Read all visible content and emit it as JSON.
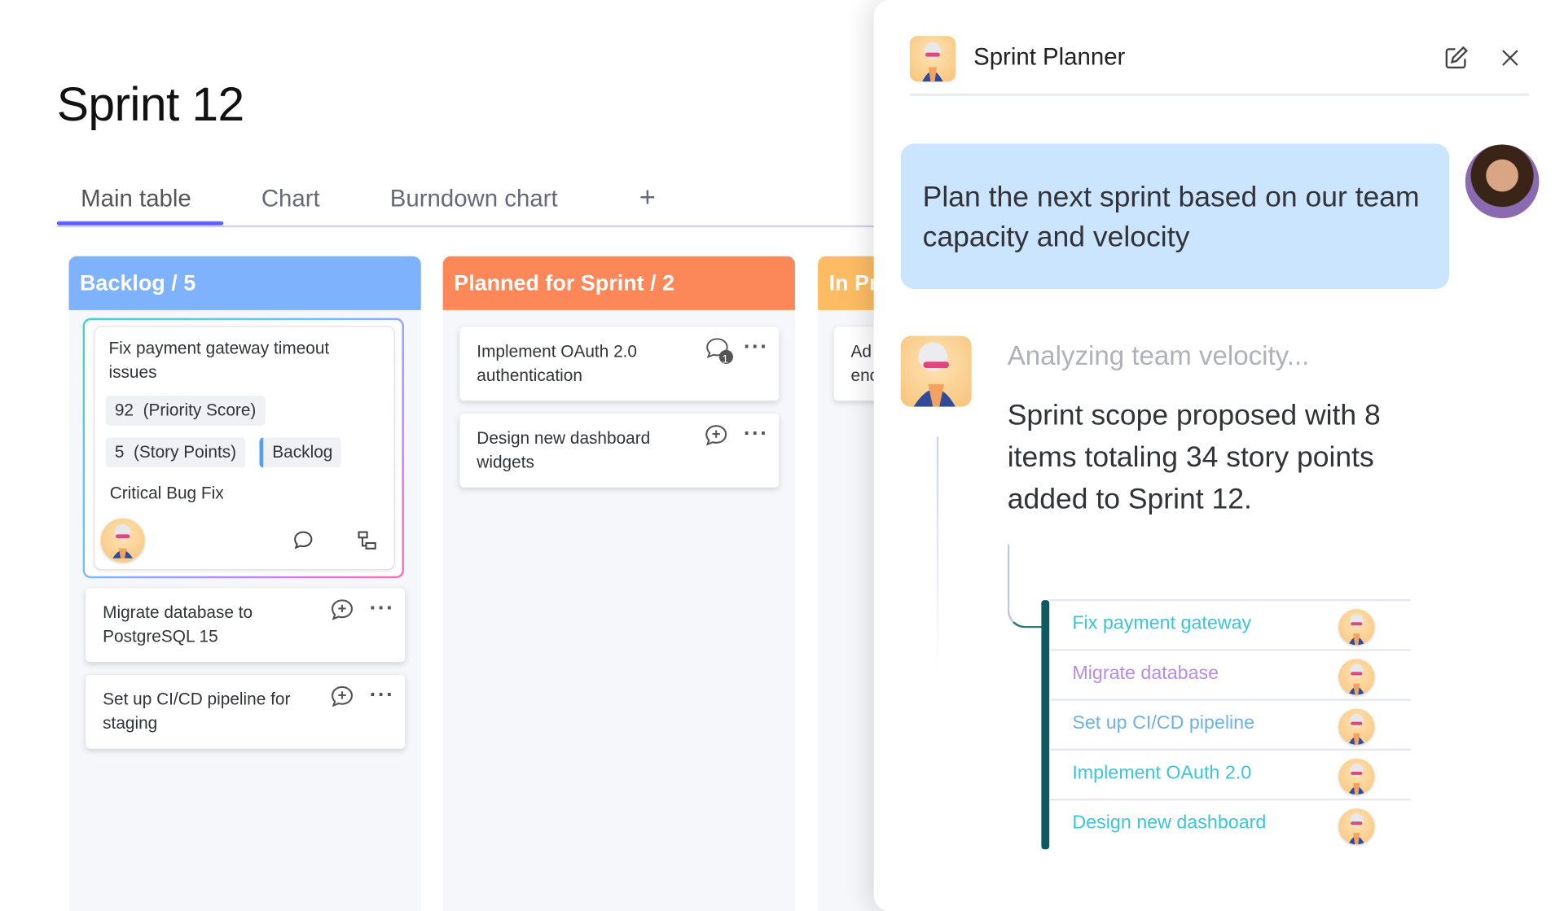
{
  "board": {
    "title": "Sprint 12",
    "tabs": [
      "Main table",
      "Chart",
      "Burndown chart"
    ],
    "add_tab_label": "+"
  },
  "columns": [
    {
      "header": "Backlog / 5",
      "color": "#7fb2fc",
      "featured_card": {
        "title": "Fix payment gateway timeout issues",
        "priority_value": "92",
        "priority_label": "(Priority Score)",
        "points_value": "5",
        "points_label": "(Story Points)",
        "status": "Backlog",
        "category": "Critical Bug Fix"
      },
      "cards": [
        {
          "title": "Migrate database to PostgreSQL 15"
        },
        {
          "title": "Set up CI/CD pipeline for staging"
        }
      ]
    },
    {
      "header": "Planned for Sprint / 2",
      "color": "#fc8859",
      "cards": [
        {
          "title": "Implement OAuth 2.0 authentication",
          "comment_count": "1"
        },
        {
          "title": "Design new dashboard widgets"
        }
      ]
    },
    {
      "header": "In Pr",
      "color": "#fdbc64",
      "cards": [
        {
          "title": "Ad\nenc"
        }
      ]
    }
  ],
  "panel": {
    "title": "Sprint Planner",
    "user_message": "Plan the next sprint based on our team capacity and velocity",
    "status": "Analyzing team velocity...",
    "response": "Sprint scope proposed with 8 items totaling 34 story points added to Sprint 12.",
    "items": [
      {
        "label": "Fix payment gateway"
      },
      {
        "label": "Migrate database"
      },
      {
        "label": "Set up CI/CD pipeline"
      },
      {
        "label": "Implement OAuth 2.0"
      },
      {
        "label": "Design new dashboard"
      }
    ]
  },
  "colors": {
    "accent": "#6161ff",
    "backlog": "#7fb2fc",
    "planned": "#fc8859",
    "in_progress": "#fdbc64",
    "user_bubble": "#cce5ff",
    "item_text_gradient": [
      "#3dc4d6",
      "#a98df0",
      "#e570c0"
    ]
  }
}
